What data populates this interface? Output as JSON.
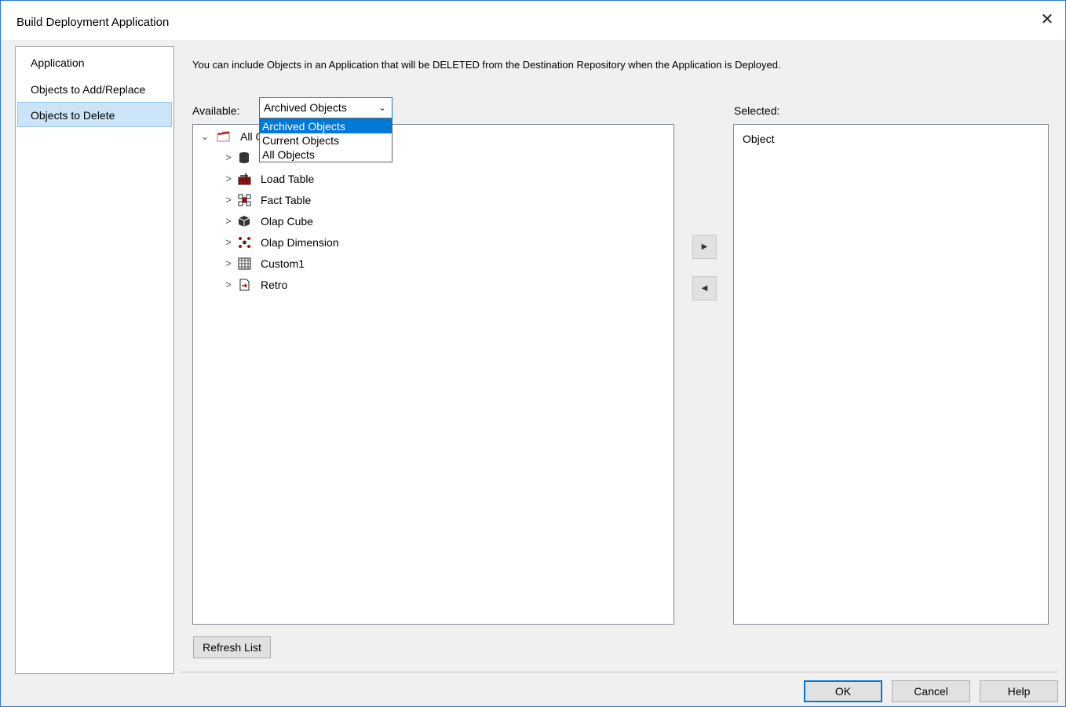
{
  "window": {
    "title": "Build Deployment Application",
    "close_glyph": "✕"
  },
  "nav": {
    "items": [
      {
        "label": "Application",
        "selected": false
      },
      {
        "label": "Objects to Add/Replace",
        "selected": false
      },
      {
        "label": "Objects to Delete",
        "selected": true
      }
    ]
  },
  "description": "You can include Objects in an Application that will be DELETED from the Destination Repository when the Application is Deployed.",
  "available": {
    "label": "Available:",
    "combo_value": "Archived Objects",
    "dropdown_options": [
      "Archived Objects",
      "Current Objects",
      "All Objects"
    ],
    "selected_option": "Archived Objects"
  },
  "tree": {
    "root_label": "All O",
    "children": [
      {
        "label": "",
        "icon": "database-icon"
      },
      {
        "label": "Load Table",
        "icon": "load-table-icon"
      },
      {
        "label": "Fact Table",
        "icon": "fact-table-icon"
      },
      {
        "label": "Olap Cube",
        "icon": "olap-cube-icon"
      },
      {
        "label": "Olap Dimension",
        "icon": "olap-dimension-icon"
      },
      {
        "label": "Custom1",
        "icon": "custom-table-icon"
      },
      {
        "label": "Retro",
        "icon": "retro-icon"
      }
    ]
  },
  "selected": {
    "label": "Selected:",
    "column_header": "Object"
  },
  "buttons": {
    "add_glyph": "▶",
    "remove_glyph": "◀",
    "refresh": "Refresh List",
    "ok": "OK",
    "cancel": "Cancel",
    "help": "Help"
  },
  "colors": {
    "accent": "#0078d7",
    "selection": "#cce4f7",
    "icon_red": "#c00000"
  }
}
